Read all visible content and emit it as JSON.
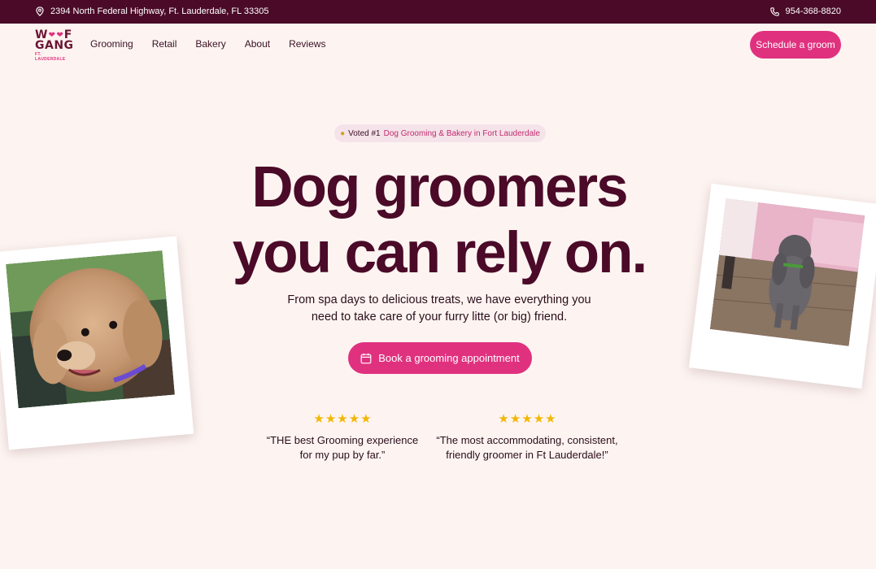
{
  "topbar": {
    "address": "2394 North Federal Highway, Ft. Lauderdale, FL 33305",
    "phone": "954-368-8820"
  },
  "logo": {
    "line1": "WOOF",
    "line2": "GANG",
    "line3": "FT. LAUDERDALE"
  },
  "nav": {
    "items": [
      "Grooming",
      "Retail",
      "Bakery",
      "About",
      "Reviews"
    ],
    "cta": "Schedule a groom"
  },
  "hero": {
    "badge_voted": "Voted #1",
    "badge_text": "Dog Grooming & Bakery in Fort Lauderdale",
    "headline_line1": "Dog groomers",
    "headline_line2": "you can rely on.",
    "subtitle_line1": "From spa days to delicious treats, we have everything you",
    "subtitle_line2": "need to take care of your furry litte (or big) friend.",
    "cta": "Book a grooming appointment"
  },
  "reviews": [
    {
      "stars": 5,
      "line1": "“THE best Grooming experience",
      "line2": "for my pup by far.”"
    },
    {
      "stars": 5,
      "line1": "“The most accommodating, consistent,",
      "line2": "friendly groomer in Ft Lauderdale!”"
    }
  ],
  "colors": {
    "brand": "#e0317f",
    "dark": "#4a0a28",
    "background": "#fdf4f1",
    "star": "#f2b705"
  },
  "icons": {
    "address": "location-pin-icon",
    "phone": "phone-icon",
    "calendar": "calendar-icon",
    "star": "star-icon",
    "medal": "medal-icon"
  }
}
